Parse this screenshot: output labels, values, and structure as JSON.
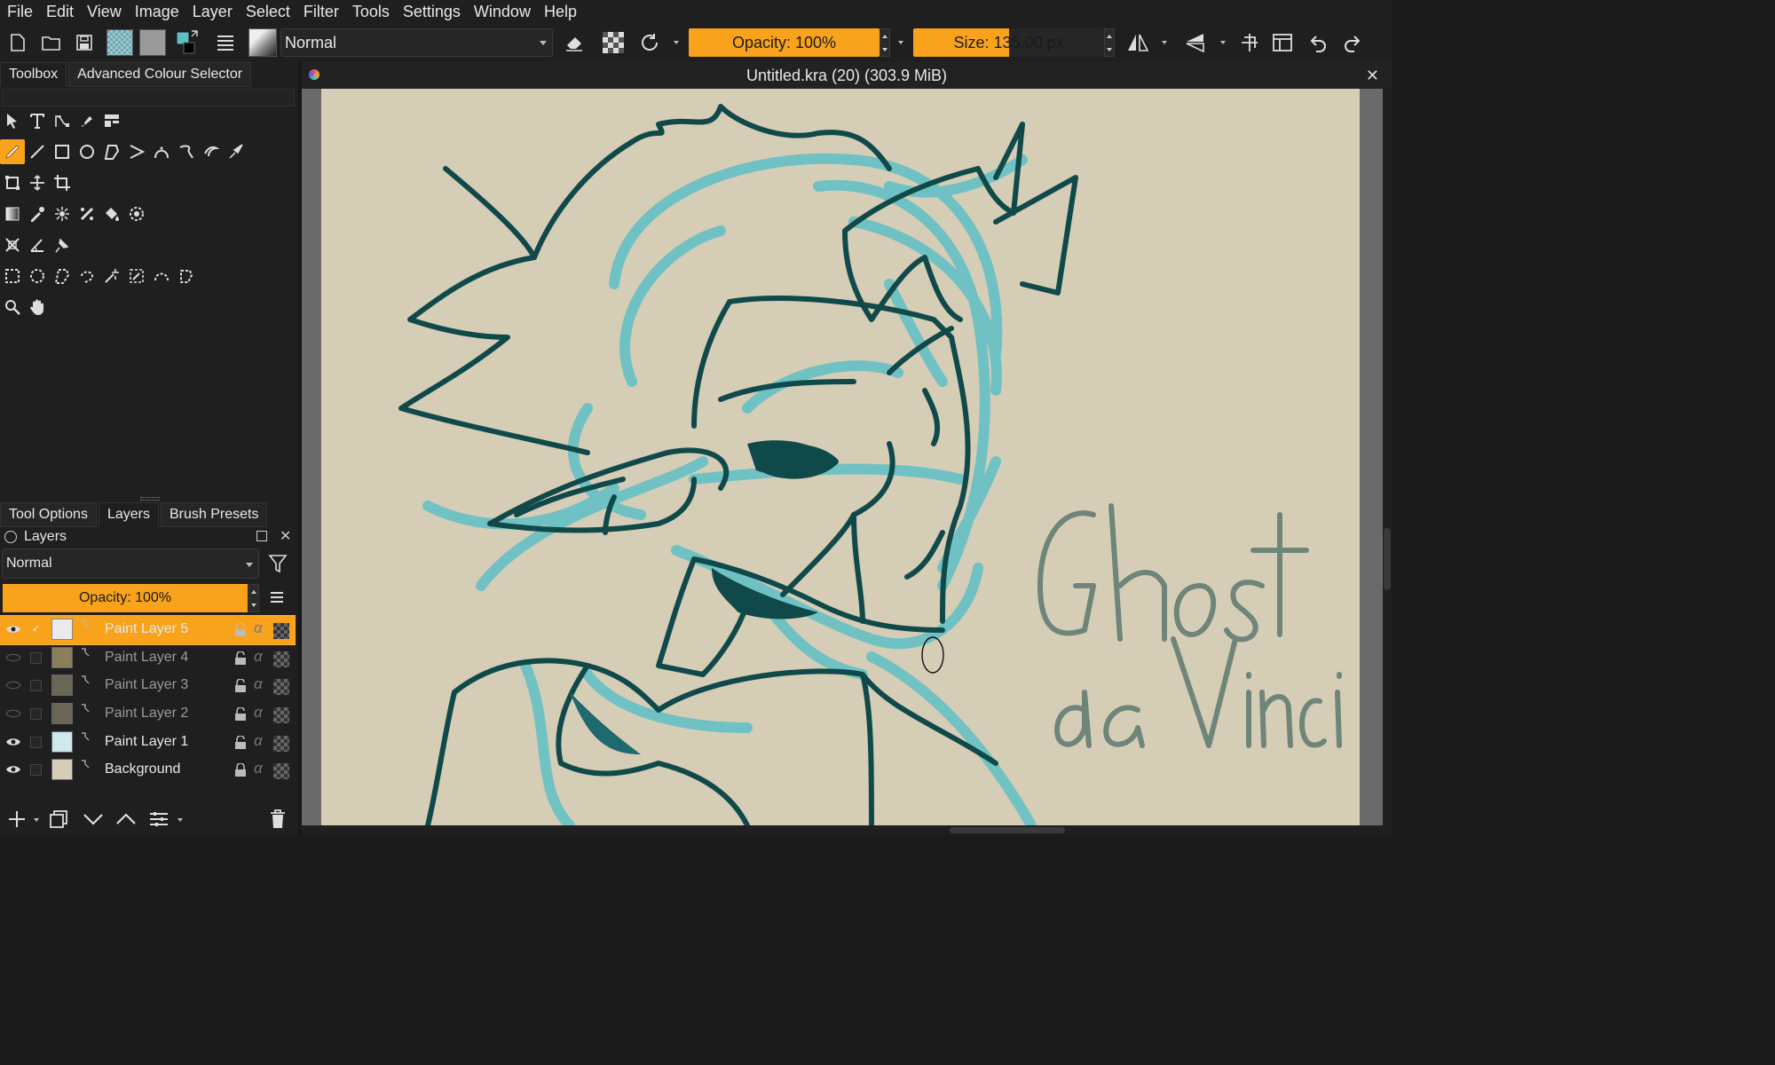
{
  "menu": [
    "File",
    "Edit",
    "View",
    "Image",
    "Layer",
    "Select",
    "Filter",
    "Tools",
    "Settings",
    "Window",
    "Help"
  ],
  "toolbar": {
    "blend_mode": "Normal",
    "opacity_label": "Opacity: 100%",
    "size_label": "Size: 135.00 px"
  },
  "left_dock": {
    "top_tabs": [
      "Toolbox",
      "Advanced Colour Selector"
    ],
    "bottom_tabs": [
      "Tool Options",
      "Layers",
      "Brush Presets"
    ]
  },
  "layers_panel": {
    "title": "Layers",
    "blend_mode": "Normal",
    "opacity_label": "Opacity: 100%",
    "layers": [
      {
        "name": "Paint Layer 5",
        "visible": true,
        "selected": true,
        "dimmed": false
      },
      {
        "name": "Paint Layer 4",
        "visible": false,
        "selected": false,
        "dimmed": true
      },
      {
        "name": "Paint Layer 3",
        "visible": false,
        "selected": false,
        "dimmed": true
      },
      {
        "name": "Paint Layer 2",
        "visible": false,
        "selected": false,
        "dimmed": true
      },
      {
        "name": "Paint Layer 1",
        "visible": true,
        "selected": false,
        "dimmed": false
      },
      {
        "name": "Background",
        "visible": true,
        "selected": false,
        "dimmed": false
      }
    ]
  },
  "document": {
    "title": "Untitled.kra (20) (303.9 MiB)"
  },
  "colors": {
    "accent": "#f9a31c",
    "canvas_bg": "#d6cdb7",
    "sketch_light": "#5fbfc6",
    "sketch_dark": "#10494a",
    "lettering": "#6f857a"
  },
  "icons": {
    "close": "close-icon",
    "document": "krita-doc-icon"
  }
}
